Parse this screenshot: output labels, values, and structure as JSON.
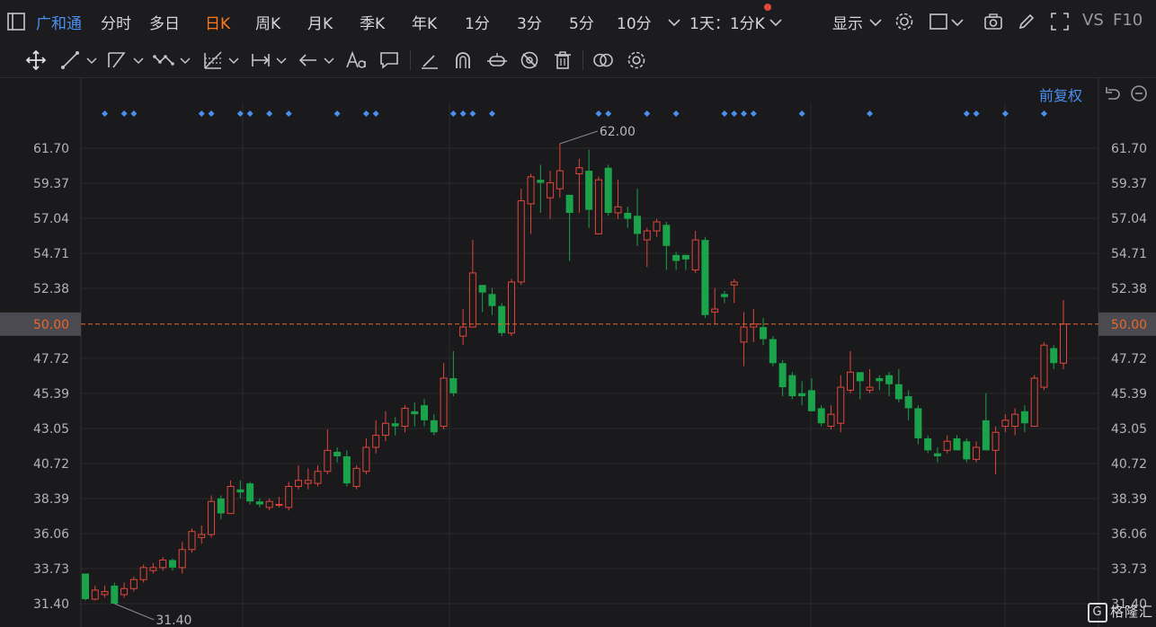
{
  "toolbar": {
    "stock_name": "广和通",
    "periods": [
      "分时",
      "多日",
      "日K",
      "周K",
      "月K",
      "季K",
      "年K",
      "1分",
      "3分",
      "5分",
      "10分"
    ],
    "active_period": "日K",
    "range_selector": "1天：1分K",
    "display_label": "显示",
    "vs_label": "VS",
    "f10_label": "F10"
  },
  "chart": {
    "adjust_label": "前复权",
    "current_price_label": "50.00",
    "high_annotation": "62.00",
    "low_annotation": "31.40"
  },
  "watermark": {
    "text": "格隆汇",
    "logo_letter": "G"
  },
  "colors": {
    "up": "#e0463c",
    "down": "#1aa34a",
    "accent": "#4a8ff0",
    "active": "#ff7a1a",
    "price_line": "#e8682a"
  },
  "chart_data": {
    "type": "candlestick",
    "ylim": [
      30.2,
      63.4
    ],
    "y_ticks": [
      "61.70",
      "59.37",
      "57.04",
      "54.71",
      "52.38",
      "50.00",
      "47.72",
      "45.39",
      "43.05",
      "40.72",
      "38.39",
      "36.06",
      "33.73",
      "31.40"
    ],
    "grid": true,
    "reference_price": 50.0,
    "candles": [
      [
        33.4,
        31.7,
        33.4,
        31.6
      ],
      [
        31.7,
        32.3,
        32.6,
        31.6
      ],
      [
        32.0,
        32.2,
        32.6,
        31.8
      ],
      [
        32.6,
        31.4,
        32.8,
        31.4
      ],
      [
        32.0,
        32.4,
        32.8,
        31.8
      ],
      [
        32.4,
        33.0,
        33.2,
        32.2
      ],
      [
        33.0,
        33.8,
        34.0,
        32.8
      ],
      [
        33.6,
        33.8,
        34.1,
        33.4
      ],
      [
        33.8,
        34.3,
        34.5,
        33.6
      ],
      [
        34.3,
        33.8,
        34.4,
        33.6
      ],
      [
        33.8,
        35.0,
        35.5,
        33.4
      ],
      [
        35.0,
        36.2,
        36.4,
        34.8
      ],
      [
        35.8,
        36.0,
        36.6,
        35.4
      ],
      [
        36.0,
        38.2,
        38.6,
        35.8
      ],
      [
        38.4,
        37.4,
        38.6,
        37.0
      ],
      [
        37.4,
        39.2,
        39.6,
        37.4
      ],
      [
        39.0,
        38.8,
        39.6,
        38.4
      ],
      [
        39.4,
        38.2,
        39.5,
        38.0
      ],
      [
        38.2,
        38.0,
        38.4,
        37.8
      ],
      [
        37.8,
        38.2,
        38.4,
        37.6
      ],
      [
        38.0,
        38.0,
        38.5,
        37.8
      ],
      [
        37.8,
        39.2,
        39.5,
        37.6
      ],
      [
        39.2,
        39.6,
        40.6,
        39.0
      ],
      [
        39.4,
        39.6,
        40.4,
        39.0
      ],
      [
        39.4,
        40.2,
        40.6,
        39.2
      ],
      [
        40.2,
        41.6,
        43.0,
        40.0
      ],
      [
        41.5,
        41.2,
        41.8,
        40.8
      ],
      [
        41.2,
        39.4,
        41.6,
        39.2
      ],
      [
        39.2,
        40.4,
        40.6,
        39.0
      ],
      [
        40.2,
        41.8,
        42.4,
        40.0
      ],
      [
        41.8,
        42.6,
        43.6,
        41.4
      ],
      [
        42.6,
        43.4,
        44.2,
        42.2
      ],
      [
        43.4,
        43.2,
        43.8,
        42.6
      ],
      [
        43.2,
        44.4,
        44.6,
        42.8
      ],
      [
        44.2,
        44.0,
        44.8,
        43.2
      ],
      [
        44.6,
        43.6,
        45.0,
        43.2
      ],
      [
        43.6,
        42.8,
        44.0,
        42.6
      ],
      [
        43.2,
        46.4,
        47.4,
        43.0
      ],
      [
        46.4,
        45.4,
        48.2,
        45.2
      ],
      [
        49.2,
        49.8,
        51.0,
        48.6
      ],
      [
        49.8,
        53.4,
        55.6,
        49.8
      ],
      [
        52.6,
        52.1,
        52.6,
        50.8
      ],
      [
        52.0,
        51.2,
        52.4,
        50.6
      ],
      [
        51.2,
        49.4,
        51.4,
        49.2
      ],
      [
        49.4,
        52.8,
        53.0,
        49.2
      ],
      [
        52.8,
        58.2,
        59.0,
        52.6
      ],
      [
        58.0,
        59.8,
        60.0,
        56.0
      ],
      [
        59.6,
        59.4,
        60.6,
        57.4
      ],
      [
        58.4,
        59.4,
        60.2,
        57.0
      ],
      [
        59.0,
        60.2,
        62.0,
        58.4
      ],
      [
        58.6,
        57.4,
        58.6,
        54.2
      ],
      [
        60.0,
        60.4,
        61.0,
        57.4
      ],
      [
        60.2,
        57.6,
        61.6,
        56.4
      ],
      [
        56.0,
        59.6,
        59.8,
        56.0
      ],
      [
        60.4,
        57.4,
        60.6,
        57.2
      ],
      [
        57.4,
        57.8,
        59.6,
        57.0
      ],
      [
        57.4,
        57.0,
        57.8,
        56.4
      ],
      [
        57.2,
        56.0,
        59.0,
        55.2
      ],
      [
        55.6,
        56.2,
        56.4,
        53.8
      ],
      [
        56.2,
        56.8,
        57.0,
        55.8
      ],
      [
        56.6,
        55.2,
        56.8,
        53.6
      ],
      [
        54.6,
        54.2,
        54.8,
        53.6
      ],
      [
        54.6,
        54.3,
        54.6,
        53.6
      ],
      [
        53.6,
        55.6,
        56.2,
        53.4
      ],
      [
        55.6,
        50.6,
        55.8,
        50.4
      ],
      [
        50.8,
        51.0,
        52.4,
        50.0
      ],
      [
        52.0,
        51.8,
        52.2,
        51.4
      ],
      [
        52.6,
        52.8,
        53.0,
        51.4
      ],
      [
        48.8,
        49.8,
        50.8,
        47.2
      ],
      [
        49.8,
        50.0,
        51.0,
        48.8
      ],
      [
        49.8,
        49.0,
        50.4,
        48.6
      ],
      [
        49.0,
        47.4,
        49.2,
        47.2
      ],
      [
        47.4,
        45.8,
        47.6,
        45.2
      ],
      [
        46.6,
        45.2,
        46.8,
        45.0
      ],
      [
        45.4,
        45.2,
        46.2,
        44.6
      ],
      [
        45.6,
        44.2,
        46.4,
        44.2
      ],
      [
        44.4,
        43.4,
        44.6,
        43.2
      ],
      [
        43.2,
        44.0,
        44.6,
        43.0
      ],
      [
        43.4,
        45.8,
        46.6,
        42.8
      ],
      [
        45.6,
        46.8,
        48.2,
        45.4
      ],
      [
        46.8,
        46.2,
        46.8,
        45.0
      ],
      [
        45.6,
        45.8,
        47.0,
        45.4
      ],
      [
        46.4,
        46.2,
        46.6,
        45.6
      ],
      [
        46.6,
        46.0,
        46.8,
        45.2
      ],
      [
        46.0,
        45.0,
        47.0,
        44.8
      ],
      [
        45.2,
        44.4,
        45.6,
        43.6
      ],
      [
        44.4,
        42.4,
        44.6,
        42.0
      ],
      [
        42.4,
        41.6,
        42.6,
        41.4
      ],
      [
        41.4,
        41.2,
        41.8,
        40.8
      ],
      [
        41.6,
        42.2,
        42.6,
        41.4
      ],
      [
        42.4,
        41.6,
        42.6,
        41.6
      ],
      [
        42.2,
        41.0,
        42.4,
        40.8
      ],
      [
        41.0,
        41.8,
        42.2,
        40.8
      ],
      [
        43.6,
        41.6,
        45.4,
        41.6
      ],
      [
        41.6,
        42.8,
        43.2,
        40.0
      ],
      [
        43.2,
        43.6,
        44.0,
        42.8
      ],
      [
        43.2,
        44.0,
        44.4,
        42.6
      ],
      [
        44.2,
        43.4,
        44.6,
        42.8
      ],
      [
        43.2,
        46.4,
        46.6,
        43.2
      ],
      [
        45.8,
        48.6,
        48.8,
        45.6
      ],
      [
        48.4,
        47.4,
        48.6,
        47.0
      ],
      [
        47.4,
        50.0,
        51.6,
        47.0
      ]
    ],
    "event_marker_indices": [
      2,
      4,
      5,
      12,
      13,
      16,
      17,
      19,
      21,
      26,
      29,
      30,
      38,
      39,
      40,
      42,
      53,
      54,
      58,
      61,
      66,
      67,
      68,
      69,
      74,
      81,
      91,
      92,
      95,
      99
    ]
  }
}
